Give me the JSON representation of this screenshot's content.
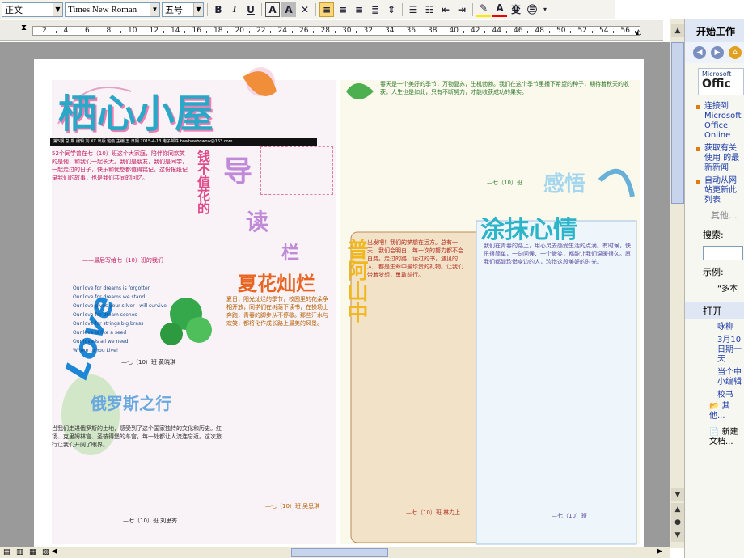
{
  "toolbar": {
    "style": "正文",
    "font": "Times New Roman",
    "size": "五号",
    "bold": "B",
    "italic": "I",
    "underline": "U",
    "char_border": "A",
    "char_shading": "A",
    "phonetic": "变",
    "font_color": "A"
  },
  "ruler": {
    "marks": [
      "2",
      "4",
      "6",
      "8",
      "10",
      "12",
      "14",
      "16",
      "18",
      "20",
      "22",
      "24",
      "26",
      "28",
      "30",
      "32",
      "34",
      "36",
      "38",
      "40",
      "42",
      "44",
      "46",
      "48",
      "50",
      "52",
      "54",
      "56"
    ]
  },
  "task_pane": {
    "title": "开始工作",
    "office_logo_small": "Microsoft",
    "office_logo": "Offic",
    "links": [
      "连接到 Microsoft Office Online",
      "获取有关使用 的最新新闻",
      "自动从网站更新此列表"
    ],
    "other": "其他...",
    "search_label": "搜索:",
    "example_label": "示例:",
    "example_text": "“多本",
    "open_title": "打开",
    "open_items": [
      "咏柳",
      "3月10日期一天",
      "当个中小编辑",
      "校书"
    ],
    "open_more": "其他...",
    "new_doc": "新建文档..."
  },
  "newspaper": {
    "masthead": "栖心小屋",
    "issue_line": "第5期 总 期   编辑 刘 XX  出版 班级  主编 王  日期 2015-4-13  电子邮件 bowbowbowow@163.com",
    "guide_title": "导读栏",
    "guide_big": "导",
    "guide_read": "读",
    "guide_bar": "栏",
    "side_heading": "钱不值花的",
    "summer_title": "夏花灿烂",
    "heart_title": "普阿山中",
    "smear_title": "涂抹心情",
    "mood_title": "感悟",
    "russia_title": "俄罗斯之行",
    "love_word": "Love",
    "poem": [
      "Our love for dreams is forgotten",
      "Our love for dreams we stand",
      "Our love gives your silver  I will survive",
      "Our love for dream scenes",
      "Our love for strings big brass",
      "Our love is like a seed",
      "Our love is all we need",
      "Where to You Live!"
    ],
    "poem_sign": "—七（10）班 黄晓琪",
    "intro_text": "52个同学曾在七（10）班这个大家庭，陪伴你同欢笑的是他，和我们一起长大。我们是朋友，我们是同学，一起走过的日子，快乐和忧愁都值得铭记。这份报纸记录我们的故事，也是我们共同的回忆。",
    "intro_sign": "——最后写给七（10）班的我们",
    "summer_text": "夏日，阳光灿烂的季节，校园里的花朵争相开放，同学们在树荫下读书，在操场上奔跑，青春的脚步从不停歇。那些汗水与欢笑，都将化作成长路上最美的风景。",
    "summer_sign": "—七（10）班 吴思琪",
    "heart_text": "出发吧！我们的梦想在远方。总有一天，我们会明白，每一次的努力都不会白费。走过的路，读过的书，遇见的人，都是生命中最珍贵的礼物。让我们带着梦想，勇敢前行。",
    "heart_sign": "—七（10）班 林力上",
    "mood_text": "春天是一个美好的季节，万物复苏，生机勃勃。我们在这个季节里播下希望的种子，期待着秋天的收获。人生也是如此，只有不断努力，才能收获成功的果实。",
    "mood_sign": "—七（10）班",
    "smear_text": "我们在青春的路上，用心灵去感受生活的点滴。有时候，快乐很简单，一句问候、一个微笑，都能让我们温暖很久。愿我们都能珍惜身边的人，珍惜这段美好的时光。",
    "smear_sign": "—七（10）班",
    "russia_text": "当我们走进俄罗斯的土地，感受到了这个国家独特的文化和历史。红场、克里姆林宫、圣彼得堡的冬宫，每一处都让人流连忘返。这次旅行让我们开阔了眼界。",
    "russia_sign": "—七（10）班 刘思秀"
  }
}
